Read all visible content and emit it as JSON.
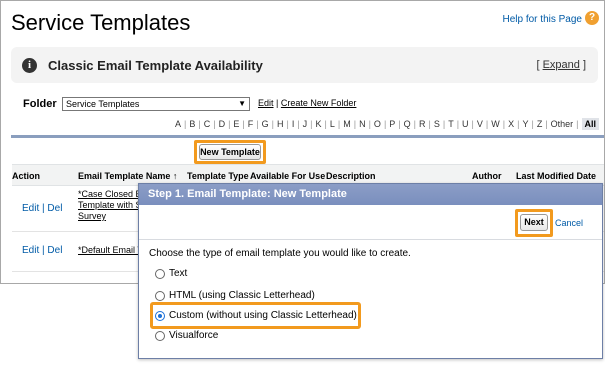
{
  "page": {
    "title": "Service Templates",
    "help_link": "Help for this Page",
    "help_icon": "question-icon"
  },
  "banner": {
    "title": "Classic Email Template Availability",
    "expand_pre": "[",
    "expand_label": "Expand",
    "expand_post": "]",
    "icon": "info-icon"
  },
  "folder": {
    "label": "Folder",
    "selected": "Service Templates",
    "edit_link": "Edit",
    "sep": "|",
    "create_link": "Create New Folder"
  },
  "alpha": [
    "A",
    "B",
    "C",
    "D",
    "E",
    "F",
    "G",
    "H",
    "I",
    "J",
    "K",
    "L",
    "M",
    "N",
    "O",
    "P",
    "Q",
    "R",
    "S",
    "T",
    "U",
    "V",
    "W",
    "X",
    "Y",
    "Z",
    "Other"
  ],
  "alpha_all": "All",
  "list": {
    "new_button": "New Template",
    "columns": [
      "Action",
      "Email Template Name ↑",
      "Template Type",
      "Available For Use",
      "Description",
      "Author",
      "Last Modified Date"
    ],
    "rows": [
      {
        "edit": "Edit",
        "sep": "|",
        "del": "Del",
        "name_lines": [
          "*Case Closed E",
          "Template with S",
          "Survey"
        ]
      },
      {
        "edit": "Edit",
        "sep": "|",
        "del": "Del",
        "name_lines": [
          "*Default Email T"
        ]
      }
    ]
  },
  "modal": {
    "title": "Step 1. Email Template: New Template",
    "next": "Next",
    "cancel": "Cancel",
    "prompt": "Choose the type of email template you would like to create.",
    "options": [
      {
        "label": "Text",
        "checked": false
      },
      {
        "label": "HTML (using Classic Letterhead)",
        "checked": false
      },
      {
        "label": "Custom (without using Classic Letterhead)",
        "checked": true
      },
      {
        "label": "Visualforce",
        "checked": false
      }
    ]
  },
  "colors": {
    "highlight": "#f29a1e",
    "link": "#015ba7",
    "modal_header": "#8b9dc6"
  }
}
